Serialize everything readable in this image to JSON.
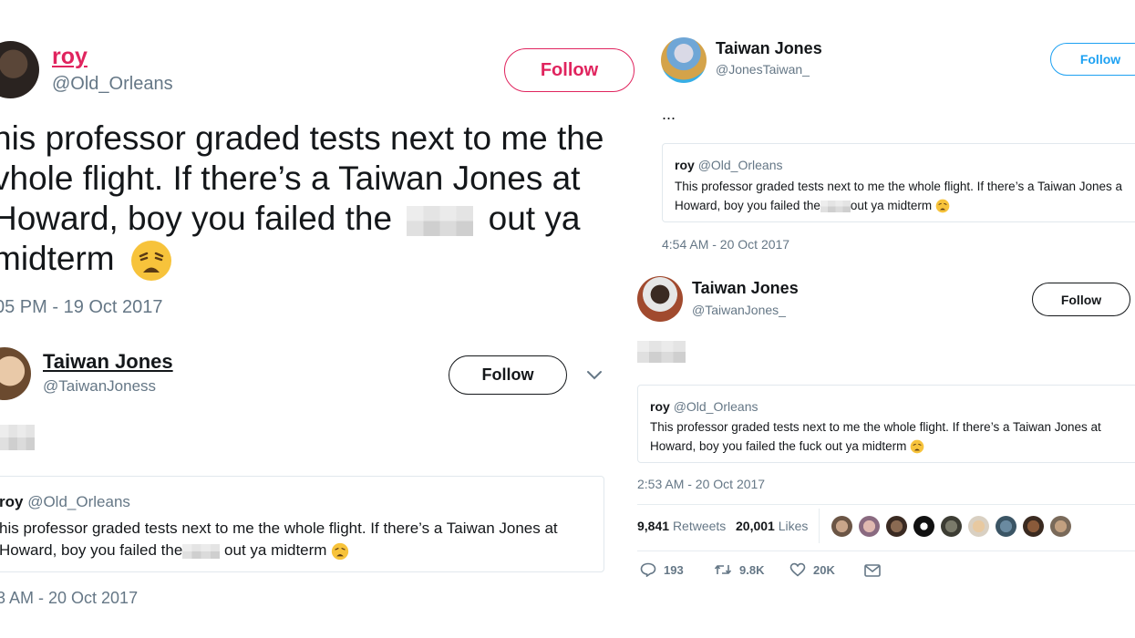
{
  "left": {
    "main": {
      "name": "roy",
      "handle": "@Old_Orleans",
      "follow": "Follow",
      "lines": [
        "his professor graded tests next to me the",
        "vhole flight. If there’s a Taiwan Jones at",
        "Howard, boy you failed the",
        "out ya",
        "midterm"
      ],
      "timestamp": "05 PM - 19 Oct 2017"
    },
    "reply": {
      "name": "Taiwan Jones",
      "handle": "@TaiwanJoness",
      "follow": "Follow",
      "quote_name": "roy",
      "quote_handle": "@Old_Orleans",
      "quote_lines": [
        "his professor graded tests next to me the whole flight. If there’s a Taiwan Jones at",
        "Howard, boy you failed the",
        "out ya midterm"
      ],
      "timestamp": "3 AM - 20 Oct 2017"
    }
  },
  "right": {
    "top": {
      "name": "Taiwan Jones",
      "handle": "@JonesTaiwan_",
      "follow": "Follow",
      "body": "...",
      "quote_name": "roy",
      "quote_handle": "@Old_Orleans",
      "quote_lines": [
        "This professor graded tests next to me the whole flight. If there’s a Taiwan Jones a",
        "Howard, boy you failed the",
        "out ya midterm"
      ],
      "timestamp": "4:54 AM - 20 Oct 2017"
    },
    "bottom": {
      "name": "Taiwan Jones",
      "handle": "@TaiwanJones_",
      "follow": "Follow",
      "quote_name": "roy",
      "quote_handle": "@Old_Orleans",
      "quote_lines": [
        "This professor graded tests next to me the whole flight. If there’s a Taiwan Jones at",
        "Howard, boy you failed the fuck out ya midterm"
      ],
      "timestamp": "2:53 AM - 20 Oct 2017",
      "retweets_count": "9,841",
      "retweets_label": "Retweets",
      "likes_count": "20,001",
      "likes_label": "Likes",
      "reply_count": "193",
      "retweet_count": "9.8K",
      "like_count": "20K"
    }
  },
  "colors": {
    "follow_red": "#e0245e",
    "link_blue": "#1da1f2",
    "muted": "#657786"
  }
}
